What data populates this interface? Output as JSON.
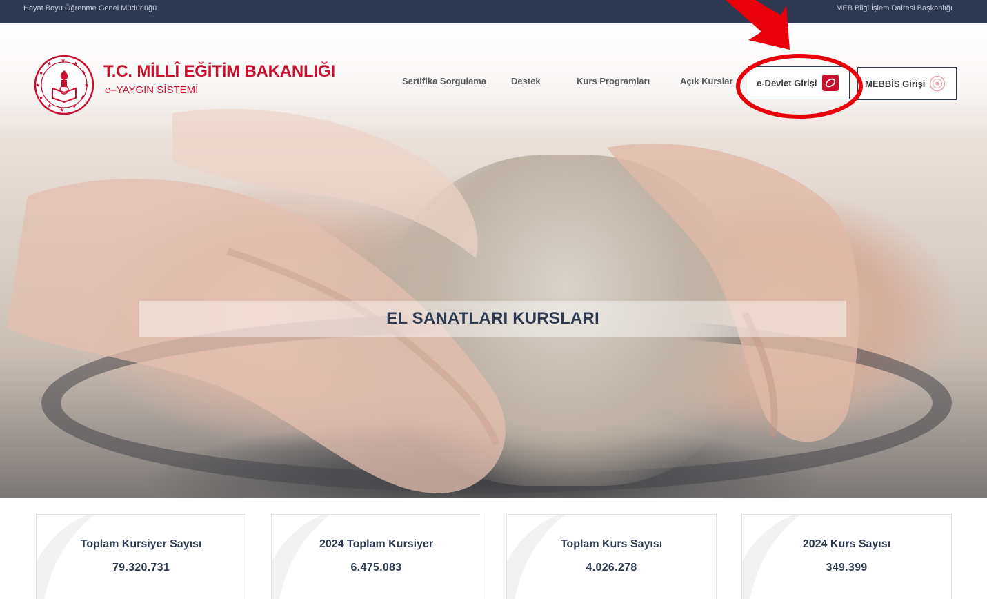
{
  "topbar": {
    "left_text": "Hayat Boyu Öğrenme Genel Müdürlüğü",
    "right_text": "MEB Bilgi İşlem Dairesi Başkanlığı"
  },
  "logo": {
    "title": "T.C. MİLLÎ EĞİTİM BAKANLIĞI",
    "subtitle": "e–YAYGIN SİSTEMİ"
  },
  "nav": {
    "items": [
      "Sertifika Sorgulama",
      "Destek",
      "Kurs Programları",
      "Açık Kurslar"
    ]
  },
  "login": {
    "edevlet_label": "e-Devlet Girişi",
    "mebbis_label": "MEBBİS Girişi"
  },
  "hero": {
    "banner_text": "EL SANATLARI KURSLARI"
  },
  "stats": [
    {
      "label": "Toplam Kursiyer Sayısı",
      "value": "79.320.731"
    },
    {
      "label": "2024 Toplam Kursiyer",
      "value": "6.475.083"
    },
    {
      "label": "Toplam Kurs Sayısı",
      "value": "4.026.278"
    },
    {
      "label": "2024 Kurs Sayısı",
      "value": "349.399"
    }
  ],
  "colors": {
    "topbar_bg": "#2d3a52",
    "brand_red": "#c8102e",
    "annotation_red": "#e8000b",
    "text_navy": "#2d3a52"
  },
  "icons": {
    "edevlet": "e-devlet-logo-icon",
    "mebbis": "meb-seal-icon",
    "ministry": "ministry-seal-icon"
  }
}
